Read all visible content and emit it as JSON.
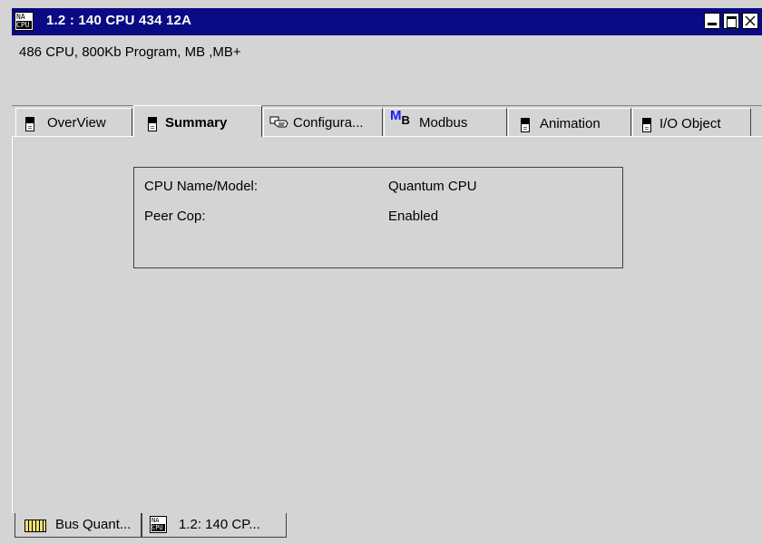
{
  "window": {
    "title": "1.2 : 140 CPU 434 12A",
    "icon_top": "NA",
    "icon_bottom": "CPU"
  },
  "description": "486 CPU, 800Kb Program, MB ,MB+",
  "tabs": [
    {
      "label": "OverView",
      "icon": "module-icon",
      "active": false
    },
    {
      "label": "Summary",
      "icon": "module-icon",
      "active": true
    },
    {
      "label": "Configura...",
      "icon": "configure-hand-icon",
      "active": false
    },
    {
      "label": "Modbus",
      "icon": "modbus-mb-icon",
      "active": false
    },
    {
      "label": "Animation",
      "icon": "module-icon",
      "active": false
    },
    {
      "label": "I/O Object",
      "icon": "module-icon",
      "active": false
    }
  ],
  "modbus_icon_text": {
    "m": "M",
    "b": "B"
  },
  "summary": {
    "cpu_name_label": "CPU Name/Model:",
    "cpu_name_value": "Quantum CPU",
    "peer_cop_label": "Peer Cop:",
    "peer_cop_value": "Enabled"
  },
  "bottom_tabs": [
    {
      "label": "Bus Quant...",
      "icon": "rack-icon"
    },
    {
      "label": "1.2: 140 CP...",
      "icon": "cpu-icon",
      "icon_top": "NA",
      "icon_bottom": "CPU"
    }
  ],
  "colors": {
    "title_bar": "#0a0a84",
    "background": "#d4d4d4",
    "modbus_icon": "#1a1aff"
  }
}
